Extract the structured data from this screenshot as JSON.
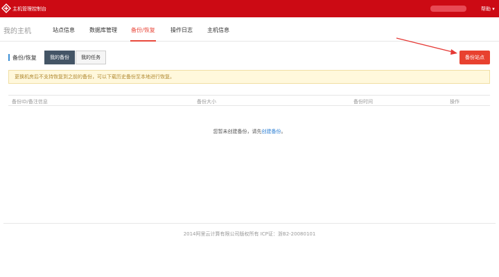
{
  "header": {
    "app_title": "主机管理控制台",
    "help_label": "帮助",
    "logo_icon": "aliyun-logo-icon",
    "bg_color": "#cc0a14"
  },
  "nav": {
    "brand": "我的主机",
    "tabs": [
      {
        "label": "站点信息"
      },
      {
        "label": "数据库管理"
      },
      {
        "label": "备份/恢复",
        "active": true
      },
      {
        "label": "操作日志"
      },
      {
        "label": "主机信息"
      }
    ],
    "accent_color": "#e8483b"
  },
  "section": {
    "title": "备份/恢复",
    "my_backup_label": "我的备份",
    "my_task_label": "我的任务",
    "backup_site_label": "备份站点"
  },
  "notice": {
    "text": "更换机房后不支持恢复到之前的备份，可以下载历史备份至本地进行恢复。"
  },
  "table": {
    "columns": [
      "备份ID/备注信息",
      "备份大小",
      "备份时间",
      "操作"
    ]
  },
  "empty": {
    "prefix": "您暂未创建备份，请先",
    "link": "创建备份",
    "suffix": "。"
  },
  "footer": {
    "text": "2014阿里云计算有限公司版权所有 ICP证：浙B2-20080101"
  }
}
